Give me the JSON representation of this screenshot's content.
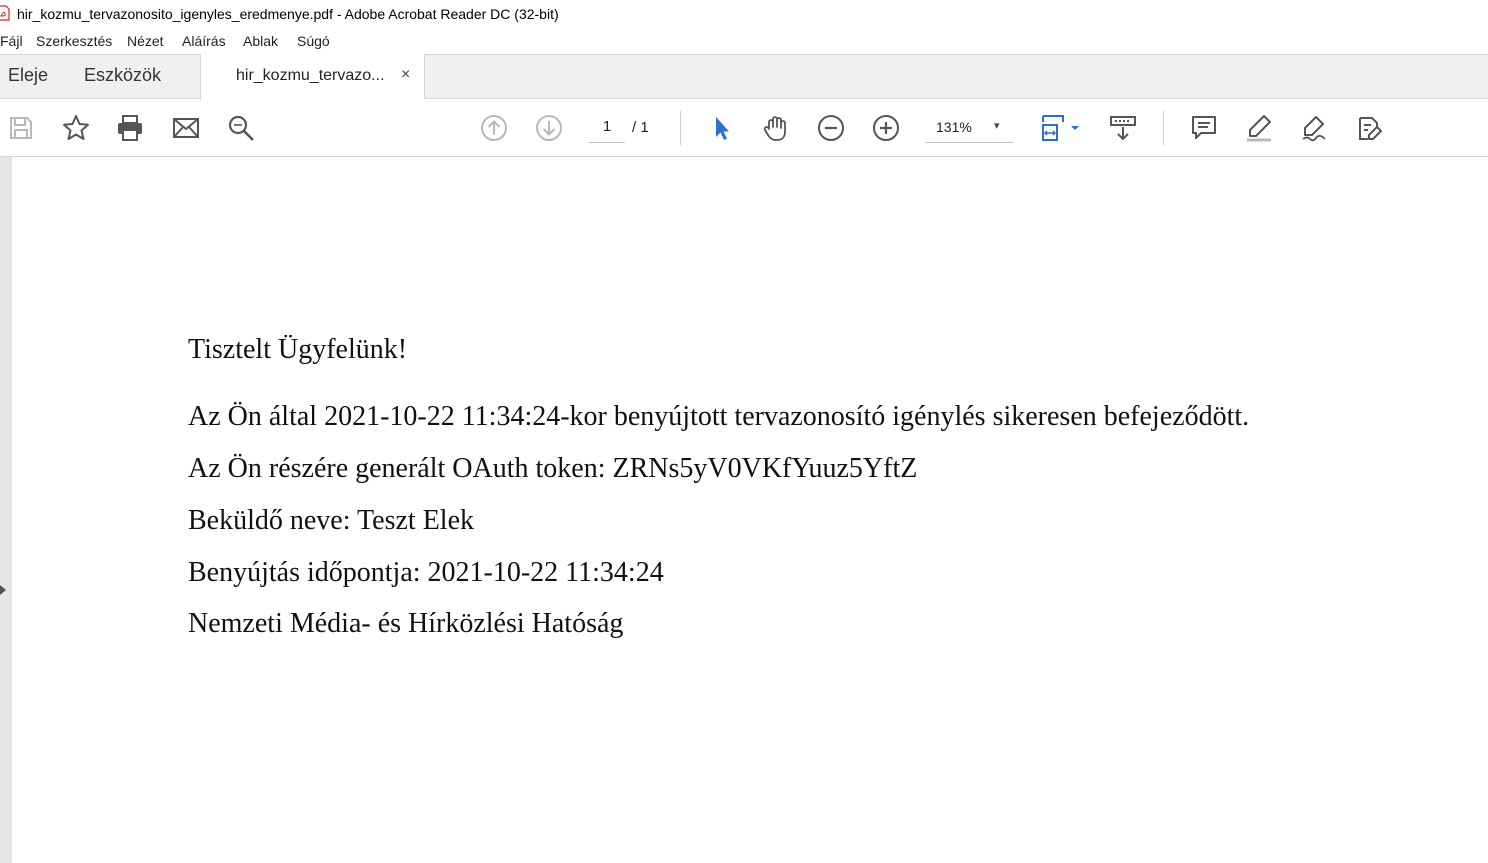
{
  "window": {
    "title": "hir_kozmu_tervazonosito_igenyles_eredmenye.pdf - Adobe Acrobat Reader DC (32-bit)"
  },
  "menu": {
    "items": [
      "Fájl",
      "Szerkesztés",
      "Nézet",
      "Aláírás",
      "Ablak",
      "Súgó"
    ]
  },
  "tabs": {
    "home": "Eleje",
    "tools": "Eszközök",
    "document": "hir_kozmu_tervazo...",
    "close": "×"
  },
  "toolbar": {
    "current_page": "1",
    "total_pages": "/ 1",
    "zoom": "131%",
    "zoom_caret": "▾"
  },
  "document": {
    "greeting": "Tisztelt Ügyfelünk!",
    "line1": "Az Ön által 2021-10-22 11:34:24-kor benyújtott tervazonosító igénylés sikeresen befejeződött.",
    "line2": "Az Ön részére generált OAuth token: ZRNs5yV0VKfYuuz5YftZ",
    "line3": "Beküldő neve: Teszt Elek",
    "line4": "Benyújtás időpontja: 2021-10-22 11:34:24",
    "line5": "Nemzeti Média- és Hírközlési Hatóság"
  },
  "colors": {
    "accent_blue": "#2c6fd1",
    "icon_gray": "#555555",
    "icon_light": "#b8b8b8",
    "pdf_red": "#d8261c"
  }
}
